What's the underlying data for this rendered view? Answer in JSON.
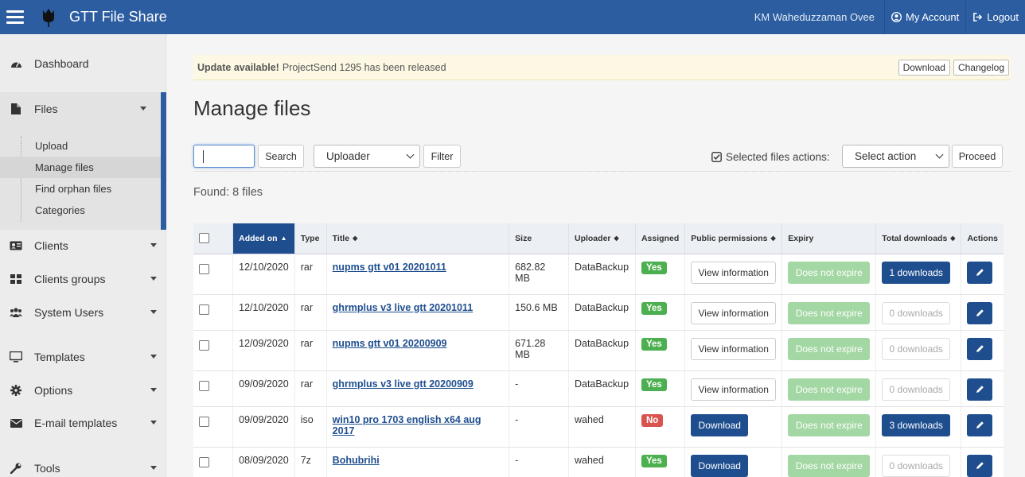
{
  "header": {
    "app_title": "GTT File Share",
    "user_name": "KM Waheduzzaman Ovee",
    "my_account": "My Account",
    "logout": "Logout",
    "brand_color": "#2b5da0"
  },
  "sidebar": {
    "items": [
      {
        "label": "Dashboard",
        "icon": "dashboard-icon"
      },
      {
        "label": "Files",
        "icon": "file-icon"
      },
      {
        "label": "Clients",
        "icon": "address-card-icon"
      },
      {
        "label": "Clients groups",
        "icon": "grid-icon"
      },
      {
        "label": "System Users",
        "icon": "users-icon"
      },
      {
        "label": "Templates",
        "icon": "monitor-icon"
      },
      {
        "label": "Options",
        "icon": "gear-icon"
      },
      {
        "label": "E-mail templates",
        "icon": "envelope-icon"
      },
      {
        "label": "Tools",
        "icon": "wrench-icon"
      }
    ],
    "files_sub": [
      "Upload",
      "Manage files",
      "Find orphan files",
      "Categories"
    ]
  },
  "alert": {
    "bold": "Update available!",
    "text": "ProjectSend 1295 has been released",
    "download": "Download",
    "changelog": "Changelog"
  },
  "page": {
    "title": "Manage files",
    "search_button": "Search",
    "uploader_select": "Uploader",
    "filter_button": "Filter",
    "selected_actions_label": "Selected files actions:",
    "action_select": "Select action",
    "proceed_button": "Proceed",
    "found": "Found: 8 files"
  },
  "table": {
    "headers": [
      "Added on",
      "Type",
      "Title",
      "Size",
      "Uploader",
      "Assigned",
      "Public permissions",
      "Expiry",
      "Total downloads",
      "Actions"
    ],
    "rows": [
      {
        "date": "12/10/2020",
        "type": "rar",
        "title": "nupms gtt v01 20201011",
        "size": "682.82 MB",
        "uploader": "DataBackup",
        "assigned": "Yes",
        "perm": "View information",
        "expiry": "Does not expire",
        "downloads": "1 downloads"
      },
      {
        "date": "12/10/2020",
        "type": "rar",
        "title": "ghrmplus v3 live gtt 20201011",
        "size": "150.6 MB",
        "uploader": "DataBackup",
        "assigned": "Yes",
        "perm": "View information",
        "expiry": "Does not expire",
        "downloads": "0 downloads"
      },
      {
        "date": "12/09/2020",
        "type": "rar",
        "title": "nupms gtt v01 20200909",
        "size": "671.28 MB",
        "uploader": "DataBackup",
        "assigned": "Yes",
        "perm": "View information",
        "expiry": "Does not expire",
        "downloads": "0 downloads"
      },
      {
        "date": "09/09/2020",
        "type": "rar",
        "title": "ghrmplus v3 live gtt 20200909",
        "size": "-",
        "uploader": "DataBackup",
        "assigned": "Yes",
        "perm": "View information",
        "expiry": "Does not expire",
        "downloads": "0 downloads"
      },
      {
        "date": "09/09/2020",
        "type": "iso",
        "title": "win10 pro 1703 english x64 aug 2017",
        "size": "-",
        "uploader": "wahed",
        "assigned": "No",
        "perm": "Download",
        "expiry": "Does not expire",
        "downloads": "3 downloads"
      },
      {
        "date": "08/09/2020",
        "type": "7z",
        "title": "Bohubrihi",
        "size": "-",
        "uploader": "wahed",
        "assigned": "Yes",
        "perm": "Download",
        "expiry": "Does not expire",
        "downloads": "0 downloads"
      }
    ]
  }
}
